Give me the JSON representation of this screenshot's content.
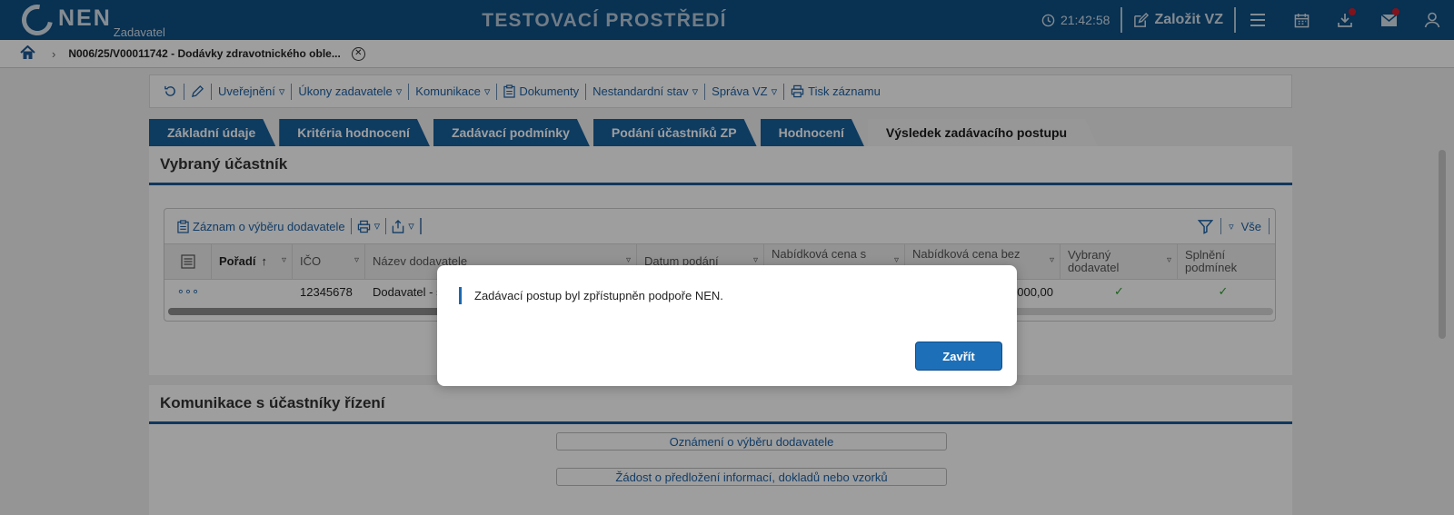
{
  "header": {
    "logo_text": "NEN",
    "logo_sub": "Zadavatel",
    "env_title": "TESTOVACÍ PROSTŘEDÍ",
    "clock": "21:42:58",
    "create_label": "Založit VZ"
  },
  "breadcrumb": {
    "text": "N006/25/V00011742 - Dodávky zdravotnického oble..."
  },
  "toolbar": {
    "items": [
      "Uveřejnění",
      "Úkony zadavatele",
      "Komunikace",
      "Dokumenty",
      "Nestandardní stav",
      "Správa VZ",
      "Tisk záznamu"
    ]
  },
  "tabs": [
    "Základní údaje",
    "Kritéria hodnocení",
    "Zadávací podmínky",
    "Podání účastníků ZP",
    "Hodnocení",
    "Výsledek zadávacího postupu"
  ],
  "section1": {
    "title": "Vybraný účastník",
    "grid_tool_label": "Záznam o výběru dodavatele",
    "grid_filter_all": "Vše",
    "columns": [
      "Pořadí",
      "IČO",
      "Název dodavatele",
      "Datum podání",
      "Nabídková cena s",
      "Nabídková cena bez",
      "Vybraný dodavatel",
      "Splnění podmínek"
    ],
    "row": {
      "ico": "12345678",
      "name": "Dodavatel - š",
      "price": "000,00"
    }
  },
  "section2": {
    "title": "Komunikace s účastníky řízení",
    "buttons": [
      "Oznámení o výběru dodavatele",
      "Žádost o předložení informací, dokladů nebo vzorků"
    ]
  },
  "modal": {
    "message": "Zadávací postup byl zpřístupněn podpoře NEN.",
    "close_label": "Zavřít"
  },
  "colors": {
    "header_bg": "#0d4f85",
    "tab_bg": "#175f9c",
    "accent": "#1d6fb8",
    "check": "#2e9b2e",
    "notification": "#d02030"
  }
}
